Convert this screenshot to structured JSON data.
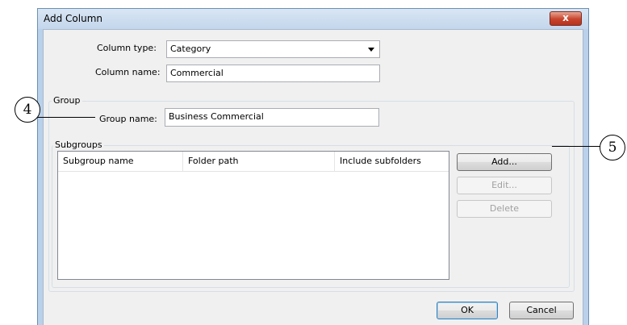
{
  "window": {
    "title": "Add Column",
    "close_label": "x"
  },
  "form": {
    "column_type_label": "Column type:",
    "column_type_value": "Category",
    "column_name_label": "Column name:",
    "column_name_value": "Commercial"
  },
  "group": {
    "title": "Group",
    "group_name_label": "Group name:",
    "group_name_value": "Business Commercial"
  },
  "subgroups": {
    "title": "Subgroups",
    "columns": [
      "Subgroup name",
      "Folder path",
      "Include subfolders"
    ],
    "rows": [],
    "add_label": "Add...",
    "edit_label": "Edit...",
    "delete_label": "Delete"
  },
  "buttons": {
    "ok_label": "OK",
    "cancel_label": "Cancel"
  },
  "callouts": {
    "group_name": "4",
    "add_button": "5"
  }
}
